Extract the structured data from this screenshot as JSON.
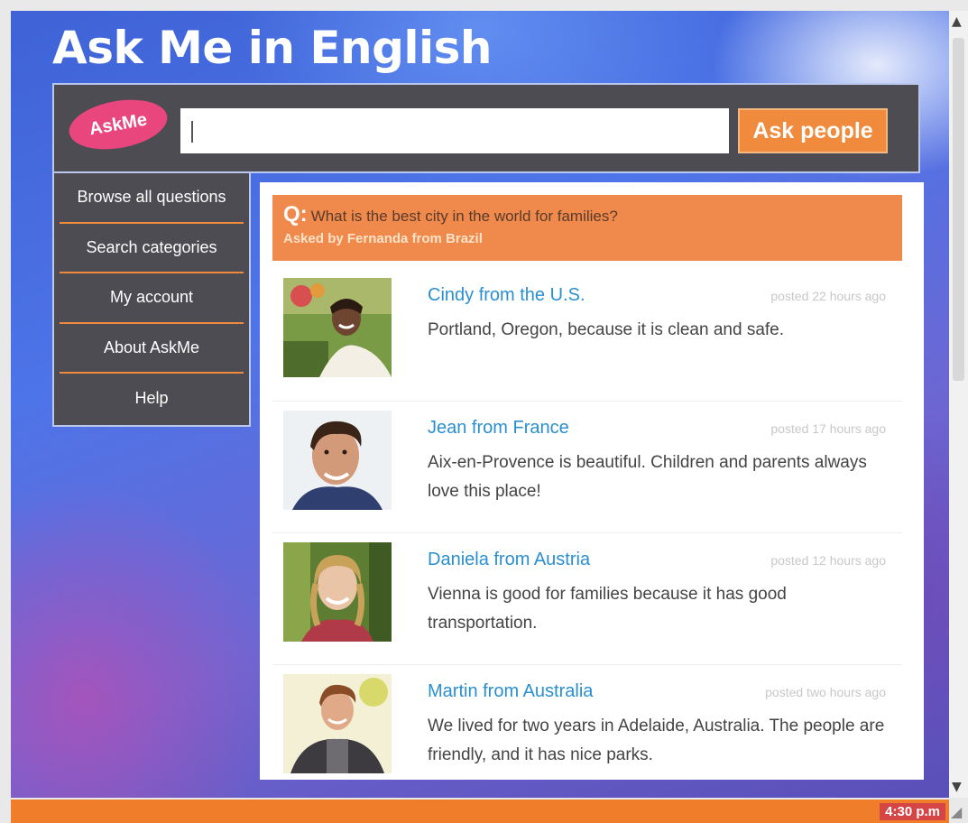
{
  "app_title": "Ask Me in English",
  "search": {
    "logo": "AskMe",
    "input_value": "",
    "button_label": "Ask people"
  },
  "sidebar": {
    "items": [
      {
        "label": "Browse all questions"
      },
      {
        "label": "Search categories"
      },
      {
        "label": "My account"
      },
      {
        "label": "About AskMe"
      },
      {
        "label": "Help"
      }
    ]
  },
  "question": {
    "prefix": "Q:",
    "text": "What is the best city in the world for families?",
    "asked_by": "Asked by Fernanda from Brazil"
  },
  "answers": [
    {
      "name": "Cindy from the U.S.",
      "time": "posted 22 hours ago",
      "text": "Portland, Oregon, because it is clean and safe."
    },
    {
      "name": "Jean from France",
      "time": "posted 17 hours ago",
      "text": "Aix-en-Provence is beautiful. Children and parents always love this place!"
    },
    {
      "name": "Daniela from Austria",
      "time": "posted 12 hours ago",
      "text": "Vienna is good for families because it has good transportation."
    },
    {
      "name": "Martin from Australia",
      "time": "posted two hours ago",
      "text": "We lived for two years in Adelaide, Australia. The people are friendly, and it has nice parks."
    }
  ],
  "taskbar": {
    "clock": "4:30 p.m"
  },
  "colors": {
    "accent_orange": "#f08a3c",
    "logo_pink": "#e8467c",
    "panel_gray": "#4d4c52",
    "name_blue": "#2a8fd0",
    "background_blue": "#4d74e8"
  },
  "icons": {
    "scroll_up": "scroll-up-arrow-icon",
    "scroll_down": "scroll-down-arrow-icon",
    "resize": "resize-grip-icon"
  }
}
